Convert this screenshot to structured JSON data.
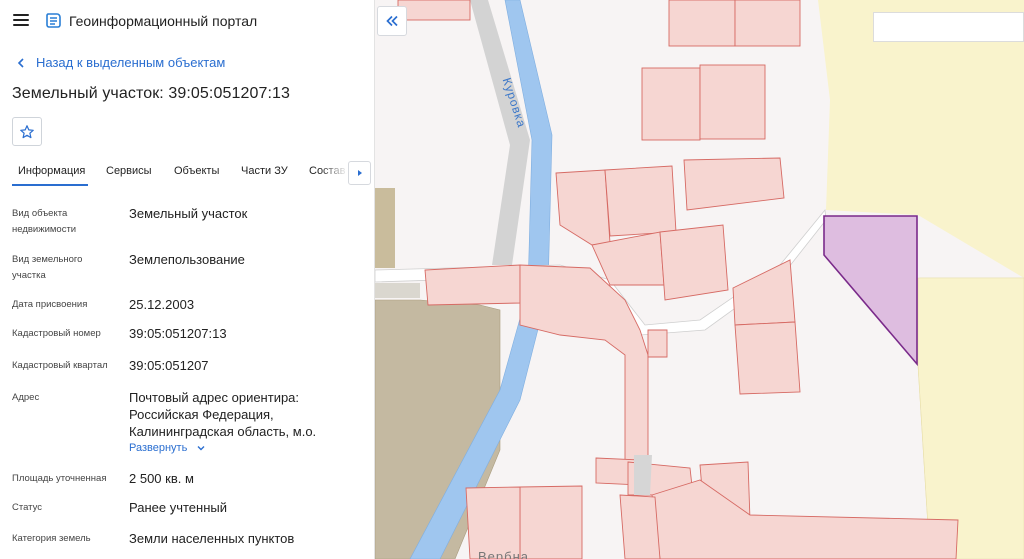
{
  "header": {
    "title": "Геоинформационный портал"
  },
  "nav": {
    "back_label": "Назад к выделенным объектам"
  },
  "object": {
    "title": "Земельный участок: 39:05:051207:13"
  },
  "tabs": [
    {
      "label": "Информация"
    },
    {
      "label": "Сервисы"
    },
    {
      "label": "Объекты"
    },
    {
      "label": "Части ЗУ"
    },
    {
      "label": "Состав"
    }
  ],
  "info": [
    {
      "label": "Вид объекта недвижимости",
      "value": "Земельный участок"
    },
    {
      "label": "Вид земельного участка",
      "value": "Землепользование"
    },
    {
      "label": "Дата присвоения",
      "value": "25.12.2003"
    },
    {
      "label": "Кадастровый номер",
      "value": "39:05:051207:13"
    },
    {
      "label": "Кадастровый квартал",
      "value": "39:05:051207"
    },
    {
      "label": "Адрес",
      "value": "Почтовый адрес ориентира: Российская Федерация, Калининградская область, м.о."
    },
    {
      "label": "Площадь уточненная",
      "value": "2 500 кв. м"
    },
    {
      "label": "Статус",
      "value": "Ранее учтенный"
    },
    {
      "label": "Категория земель",
      "value": "Земли населенных пунктов"
    }
  ],
  "address_expand_label": "Развернуть",
  "map": {
    "river_label": "Куровка",
    "street_label": "Вербна",
    "search": {
      "value": "",
      "placeholder": ""
    }
  },
  "colors": {
    "accent": "#2a6ed0",
    "selected_fill": "#d9b3dc",
    "selected_stroke": "#7a2a8a",
    "parcel_fill": "#f6d6d2",
    "parcel_stroke": "#d66a64",
    "river": "#9fc6ef",
    "field": "#f9f3cc"
  },
  "icons": [
    "menu-icon",
    "portal-logo-icon",
    "chevron-left-icon",
    "star-icon",
    "chevron-right-icon",
    "chevron-down-icon",
    "double-chevron-left-icon"
  ]
}
